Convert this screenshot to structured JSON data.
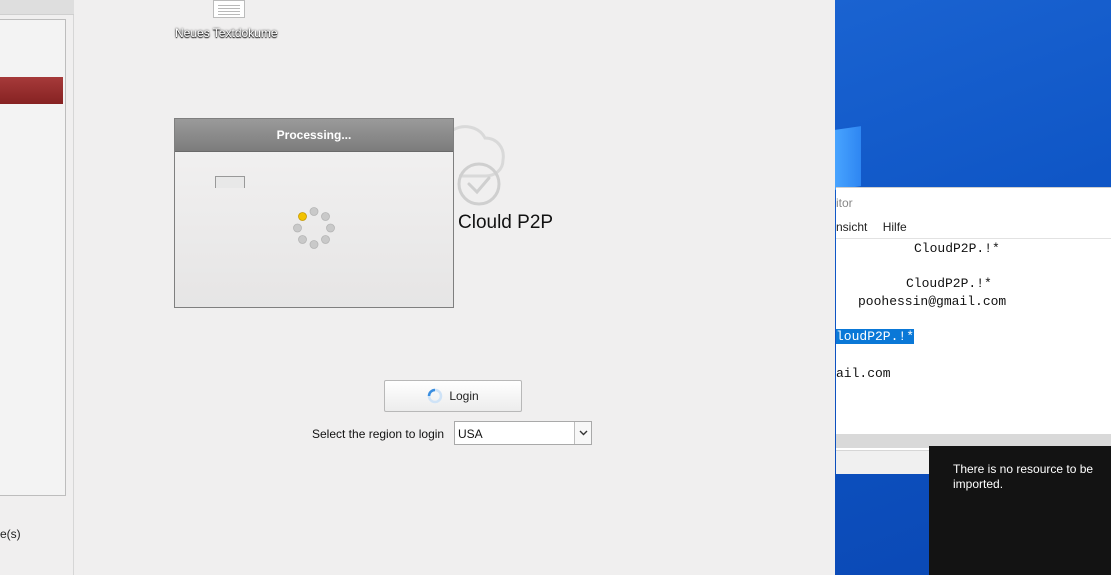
{
  "left_pane": {
    "files_label": "e(s)"
  },
  "processing_dialog": {
    "title": "Processing..."
  },
  "brand": {
    "name": "Clould P2P"
  },
  "login": {
    "button_label": "Login",
    "region_label": "Select the region to login",
    "region_selected": "USA"
  },
  "desktop": {
    "icon_label": "Neues Textdokume"
  },
  "notepad": {
    "title_fragment": "itor",
    "menu": [
      "nsicht",
      "Hilfe"
    ],
    "lines": [
      "CloudP2P.!*",
      "CloudP2P.!*",
      "poohessin@gmail.com",
      "loudP2P.!*",
      "ail.com"
    ]
  },
  "toast": {
    "message": "There is no resource to be imported."
  },
  "colors": {
    "selected_item": "#8f2b2b",
    "desktop_blue": "#1159c9",
    "selection_blue": "#0a78d7",
    "spinner_active": "#f2c200"
  }
}
